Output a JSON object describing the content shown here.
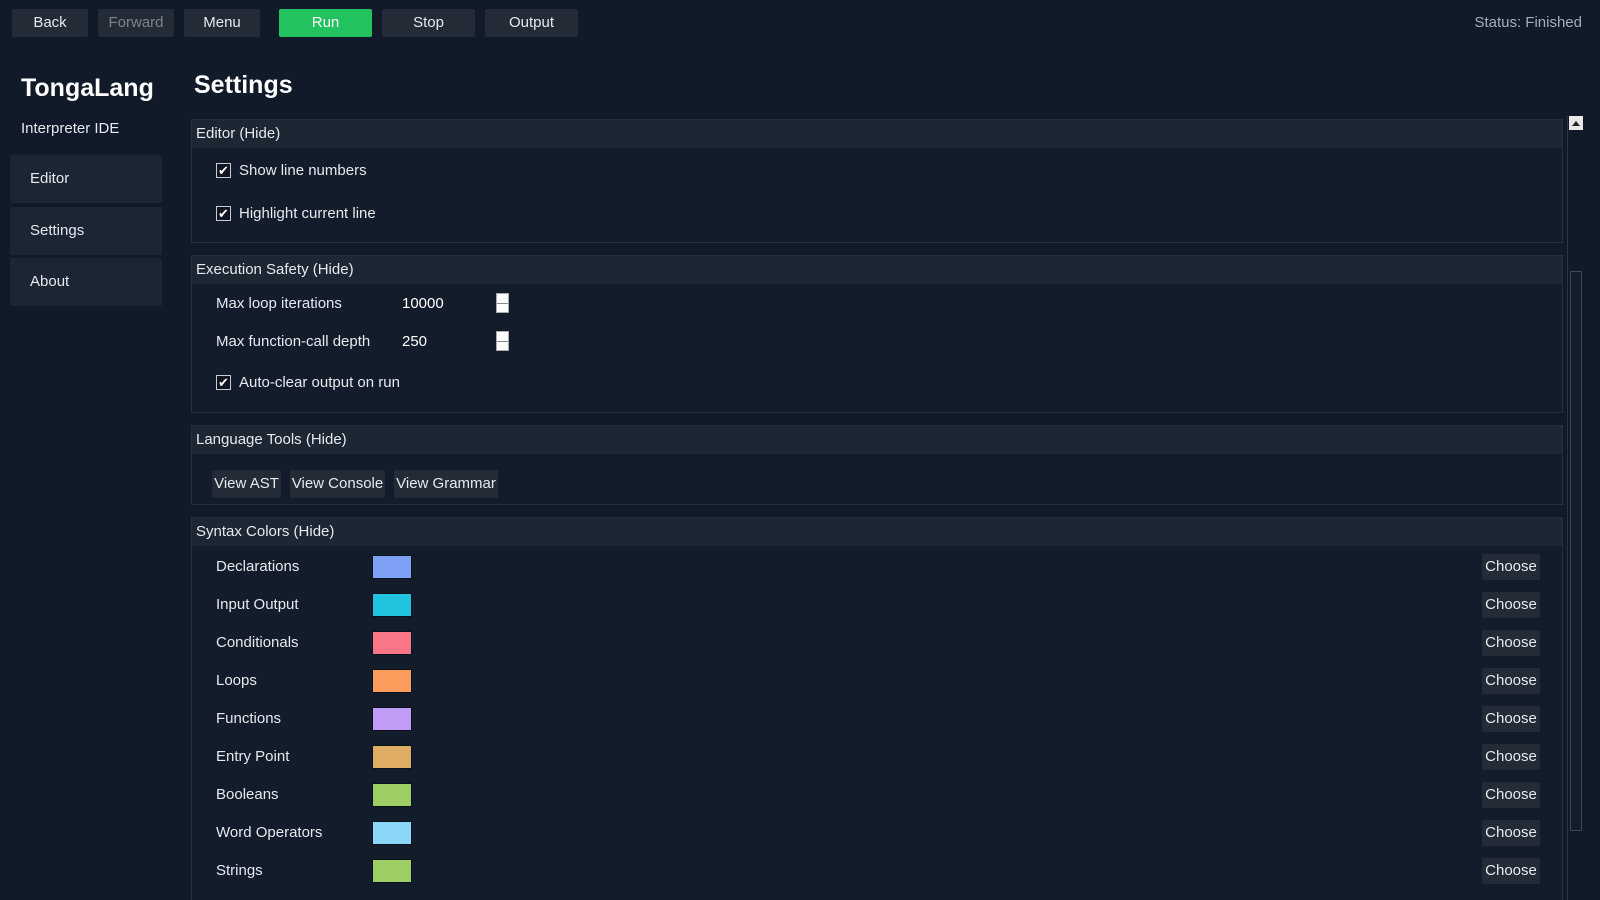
{
  "toolbar": {
    "back_label": "Back",
    "forward_label": "Forward",
    "menu_label": "Menu",
    "run_label": "Run",
    "stop_label": "Stop",
    "output_label": "Output",
    "status": "Status: Finished"
  },
  "sidebar": {
    "brand": "TongaLang",
    "subtitle": "Interpreter IDE",
    "items": [
      {
        "label": "Editor"
      },
      {
        "label": "Settings"
      },
      {
        "label": "About"
      }
    ]
  },
  "page": {
    "title": "Settings"
  },
  "sections": {
    "editor": {
      "header": "Editor  (Hide)",
      "show_line_numbers": "Show line numbers",
      "highlight_current_line": "Highlight current line"
    },
    "execution": {
      "header": "Execution Safety  (Hide)",
      "max_loop_label": "Max loop iterations",
      "max_loop_value": "10000",
      "max_depth_label": "Max function-call depth",
      "max_depth_value": "250",
      "auto_clear_label": "Auto-clear output on run"
    },
    "tools": {
      "header": "Language Tools  (Hide)",
      "view_ast": "View AST",
      "view_console": "View Console",
      "view_grammar": "View Grammar"
    },
    "syntax": {
      "header": "Syntax Colors  (Hide)",
      "choose_label": "Choose",
      "items": [
        {
          "label": "Declarations",
          "color": "#7ea0f5"
        },
        {
          "label": "Input Output",
          "color": "#22c3df"
        },
        {
          "label": "Conditionals",
          "color": "#f87687"
        },
        {
          "label": "Loops",
          "color": "#fb9c5c"
        },
        {
          "label": "Functions",
          "color": "#c09cf7"
        },
        {
          "label": "Entry Point",
          "color": "#e0ad66"
        },
        {
          "label": "Booleans",
          "color": "#9fce66"
        },
        {
          "label": "Word Operators",
          "color": "#8ad7f7"
        },
        {
          "label": "Strings",
          "color": "#9fce66"
        }
      ]
    }
  }
}
